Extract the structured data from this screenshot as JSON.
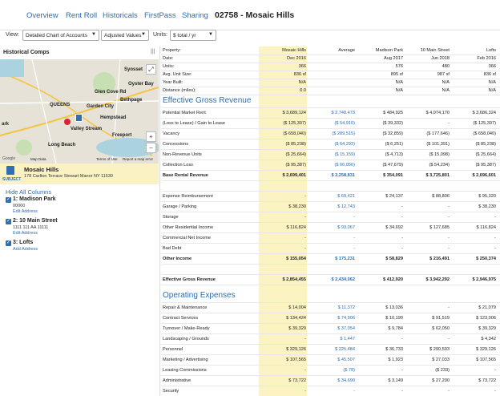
{
  "nav": {
    "tabs": [
      "Overview",
      "Rent Roll",
      "Historicals",
      "FirstPass",
      "Sharing"
    ],
    "title": "02758 - Mosaic Hills"
  },
  "toolbar": {
    "view_label": "View:",
    "view_value": "Detailed Chart of Accounts",
    "values_value": "Adjusted Values",
    "units_label": "Units:",
    "units_value": "$ total / yr"
  },
  "sidebar": {
    "title": "Historical Comps",
    "map_labels": [
      "Syosset",
      "Glen Cove Rd",
      "Oyster Bay",
      "QUEENS",
      "Garden City",
      "ark",
      "Valley Stream",
      "Hempstead",
      "Freeport",
      "Bethpage",
      "Long Beach"
    ],
    "map_footer": [
      "Map Data",
      "Terms of Use",
      "Report a map error"
    ],
    "subject_label": "SUBJECT",
    "subject_name": "Mosaic Hills",
    "subject_addr": "178 Carlton Terrace Stewart Manor NY 11530",
    "hide_all": "Hide All Columns",
    "comps": [
      {
        "name": "1: Madison Park",
        "line1": "00000",
        "line2": "",
        "edit": "Edit Address"
      },
      {
        "name": "2: 10 Main Street",
        "line1": "1111 111 AA 11111",
        "line2": "",
        "edit": "Edit Address"
      },
      {
        "name": "3: Lofts",
        "line1": "",
        "line2": "",
        "edit": "Add Address"
      }
    ]
  },
  "grid": {
    "header_rows": [
      [
        "Property:",
        "Mosaic Hills",
        "Average",
        "Madison Park",
        "10 Main Street",
        "Lofts"
      ],
      [
        "Date:",
        "Dec 2016",
        "",
        "Aug 2017",
        "Jun 2018",
        "Feb 2016"
      ],
      [
        "Units:",
        "366",
        "",
        "576",
        "480",
        "366"
      ],
      [
        "Avg. Unit Size:",
        "836 sf",
        "",
        "895 sf",
        "987 sf",
        "836 sf"
      ],
      [
        "Year Built:",
        "N/A",
        "",
        "N/A",
        "N/A",
        "N/A"
      ],
      [
        "Distance (miles):",
        "0.0",
        "",
        "N/A",
        "N/A",
        "N/A"
      ]
    ],
    "sections": [
      {
        "title": "Effective Gross Revenue",
        "rows": [
          [
            "Potential Market Rent",
            "$ 3,689,124",
            "$ 2,748,473",
            "$ 484,925",
            "$ 4,074,170",
            "$ 3,686,324"
          ],
          [
            "(Loss to Lease) / Gain to Lease",
            "($ 125,397)",
            "($ 54,910)",
            "($ 39,332)",
            "-",
            "($ 125,397)"
          ],
          [
            "Vacancy",
            "($ 658,040)",
            "($ 289,515)",
            "($ 32,859)",
            "($ 177,646)",
            "($ 658,040)"
          ],
          [
            "Concessions",
            "($ 85,238)",
            "($ 64,292)",
            "($ 6,251)",
            "($ 101,391)",
            "($ 85,238)"
          ],
          [
            "Non-Revenue Units",
            "($ 25,664)",
            "($ 15,159)",
            "($ 4,713)",
            "($ 15,098)",
            "($ 25,664)"
          ],
          [
            "Collection Loss",
            "($ 95,387)",
            "($ 66,056)",
            "($ 47,679)",
            "($ 54,234)",
            "($ 95,387)"
          ],
          [
            "Base Rental Revenue",
            "$ 2,699,401",
            "$ 2,258,831",
            "$ 354,091",
            "$ 3,725,801",
            "$ 2,696,601"
          ],
          [
            "",
            "",
            "",
            "",
            "",
            ""
          ],
          [
            "Expense Reimbursement",
            "-",
            "$ 69,421",
            "$ 24,137",
            "$ 88,806",
            "$ 95,320"
          ],
          [
            "Garage / Parking",
            "$ 38,230",
            "$ 12,743",
            "-",
            "-",
            "$ 38,230"
          ],
          [
            "Storage",
            "-",
            "-",
            "-",
            "-",
            "-"
          ],
          [
            "Other Residential Income",
            "$ 116,824",
            "$ 93,067",
            "$ 34,692",
            "$ 127,685",
            "$ 116,824"
          ],
          [
            "Commercial Net Income",
            "-",
            "-",
            "-",
            "-",
            "-"
          ],
          [
            "Bad Debt",
            "-",
            "-",
            "-",
            "-",
            "-"
          ],
          [
            "Other Income",
            "$ 155,054",
            "$ 175,231",
            "$ 58,829",
            "$ 216,491",
            "$ 250,374"
          ],
          [
            "",
            "",
            "",
            "",
            "",
            ""
          ],
          [
            "Effective Gross Revenue",
            "$ 2,854,455",
            "$ 2,434,062",
            "$ 412,920",
            "$ 3,942,292",
            "$ 2,946,975"
          ]
        ]
      },
      {
        "title": "Operating Expenses",
        "rows": [
          [
            "Repair & Maintenance",
            "$ 14,004",
            "$ 11,372",
            "$ 13,036",
            "-",
            "$ 21,079"
          ],
          [
            "Contract Services",
            "$ 134,424",
            "$ 74,906",
            "$ 10,190",
            "$ 91,519",
            "$ 123,006"
          ],
          [
            "Turnover / Make-Ready",
            "$ 39,329",
            "$ 37,054",
            "$ 9,784",
            "$ 62,050",
            "$ 39,329"
          ],
          [
            "Landscaping / Grounds",
            "-",
            "$ 1,447",
            "-",
            "-",
            "$ 4,342"
          ],
          [
            "Personnel",
            "$ 329,126",
            "$ 225,484",
            "$ 36,733",
            "$ 290,593",
            "$ 329,126"
          ],
          [
            "Marketing / Advertising",
            "$ 107,565",
            "$ 45,507",
            "$ 1,923",
            "$ 27,033",
            "$ 107,565"
          ],
          [
            "Leasing Commissions",
            "-",
            "($ 78)",
            "-",
            "($ 233)",
            "-"
          ],
          [
            "Administrative",
            "$ 73,722",
            "$ 34,690",
            "$ 3,149",
            "$ 27,200",
            "$ 73,722"
          ],
          [
            "Security",
            "-",
            "-",
            "-",
            "-",
            "-"
          ]
        ]
      }
    ]
  }
}
